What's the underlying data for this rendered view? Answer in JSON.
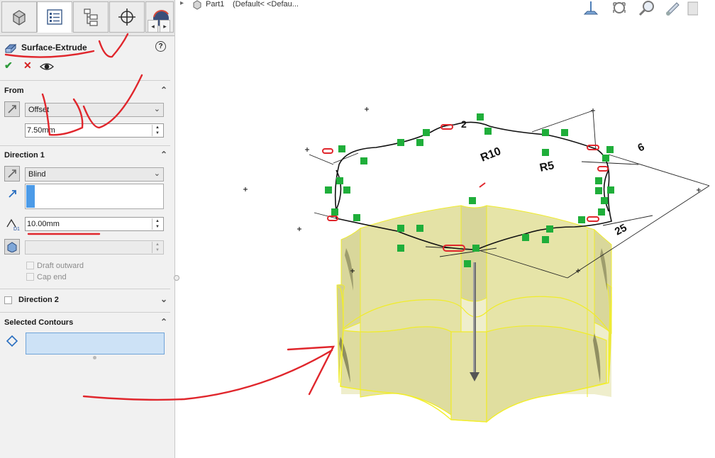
{
  "window": {
    "document_title": "Part1",
    "configuration": "(Default< <Defau..."
  },
  "panel_tabs": {
    "items": [
      {
        "name": "feature-manager",
        "icon": "part-icon"
      },
      {
        "name": "property-manager",
        "icon": "property-manager-icon",
        "active": true
      },
      {
        "name": "configuration-manager",
        "icon": "configuration-icon"
      },
      {
        "name": "dimxpert-manager",
        "icon": "crosshair-icon"
      },
      {
        "name": "display-manager",
        "icon": "appearance-sphere-icon"
      }
    ],
    "nav_left": "◂",
    "nav_right": "▸"
  },
  "feature": {
    "title": "Surface-Extrude",
    "help": "?",
    "ok_icon": "✔",
    "cancel_icon": "✕",
    "preview_icon": "eye-icon"
  },
  "from_section": {
    "header": "From",
    "collapse_icon": "chevron-up-icon",
    "condition": "Offset",
    "offset_value": "7.50mm"
  },
  "direction1": {
    "header": "Direction 1",
    "end_condition": "Blind",
    "depth": "10.00mm",
    "draft_outward": "Draft outward",
    "cap_end": "Cap end"
  },
  "direction2": {
    "header": "Direction 2",
    "checked": false
  },
  "selected_contours": {
    "header": "Selected Contours"
  },
  "sketch": {
    "dimension_labels": [
      "R10",
      "R5",
      "6",
      "25",
      "2"
    ],
    "relation_counts": [
      "0",
      "1",
      "5",
      "0",
      "3",
      "2",
      "4",
      "1"
    ]
  },
  "colors": {
    "surface_fill": "#e4e2a4",
    "surface_edge": "#f2ee2c",
    "annotation_red": "#e0262c",
    "relation_green": "#1fae3a",
    "panel_bg": "#f1f1f1",
    "contour_box": "#cde2f6"
  },
  "view_toolbar": {
    "icons": [
      "view-normal-icon",
      "zoom-to-fit-icon",
      "zoom-area-icon",
      "previous-view-icon",
      "section-view-icon"
    ]
  }
}
